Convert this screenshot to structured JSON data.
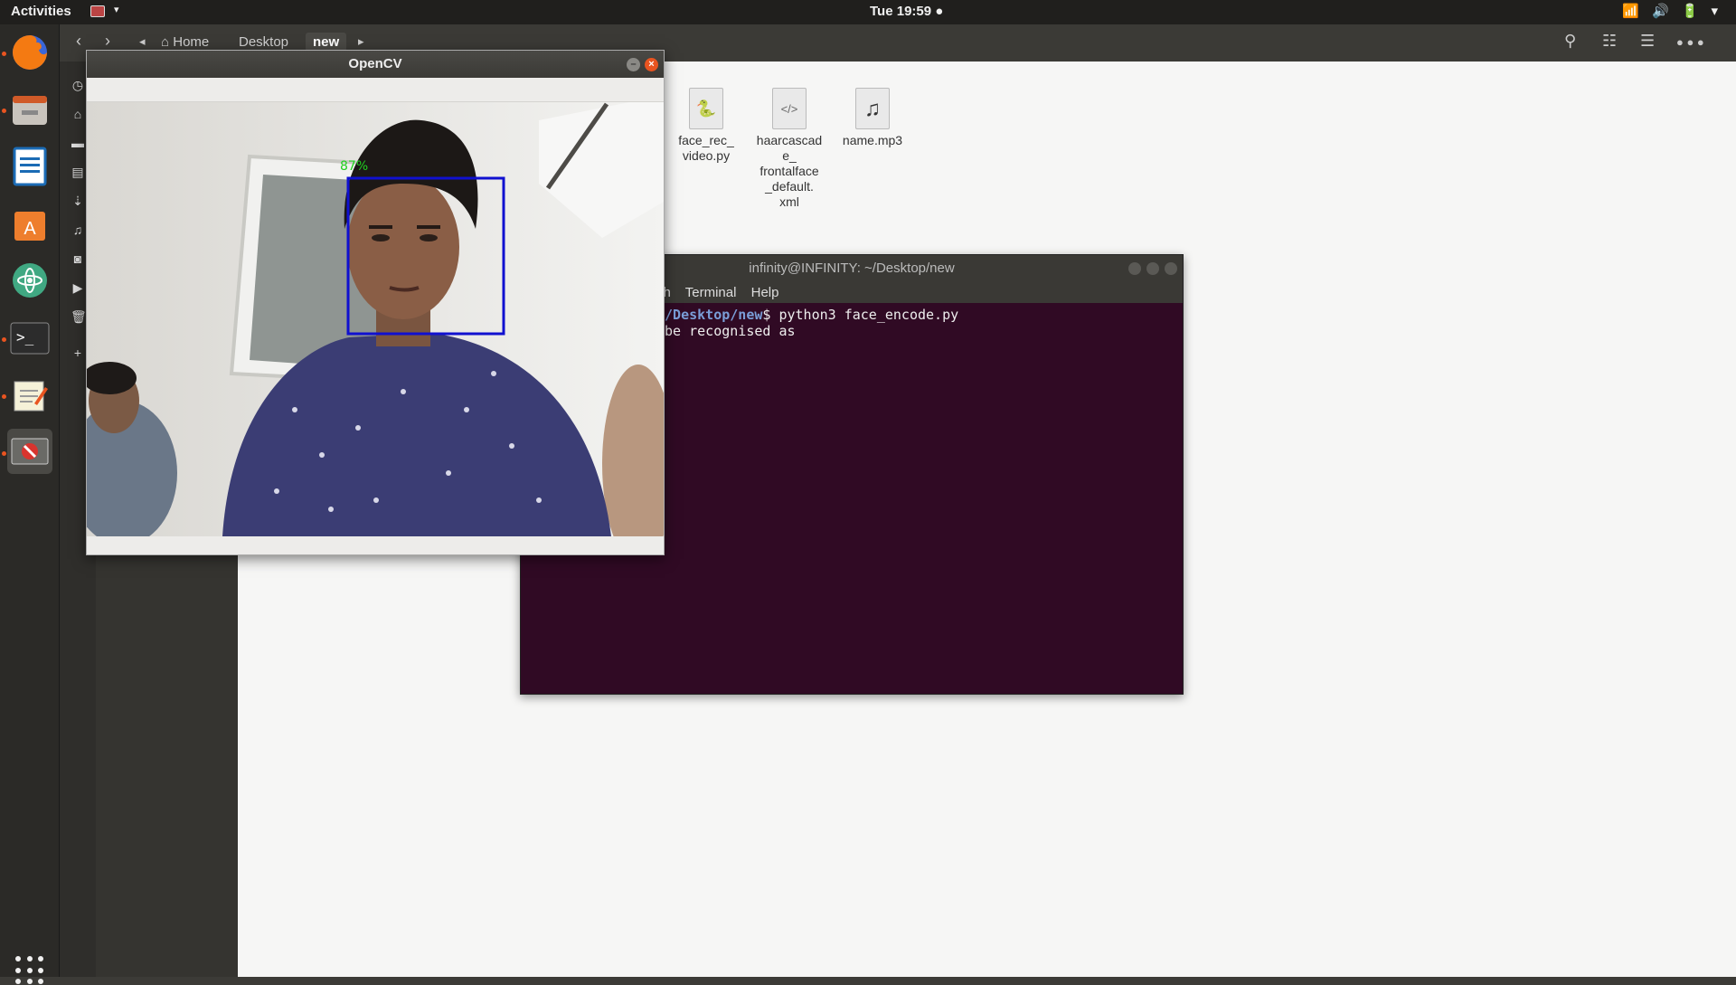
{
  "topbar": {
    "activities": "Activities",
    "clock": "Tue 19:59 ●",
    "appmenu_arrow": "▾",
    "tray": [
      "wifi-icon",
      "volume-icon",
      "battery-icon",
      "menu-arrow"
    ]
  },
  "dock": {
    "items": [
      "firefox",
      "files",
      "libreoffice-writer",
      "software-center",
      "atom",
      "terminal",
      "text-editor",
      "opencv-window"
    ]
  },
  "files": {
    "nav": {
      "back": "‹",
      "forward": "›",
      "left_arrow": "◂",
      "right_arrow": "▸"
    },
    "breadcrumbs": [
      "Home",
      "Desktop",
      "new"
    ],
    "items": [
      {
        "name": "face_rec_\nvideo.py",
        "icon": "python-file-icon",
        "glyph": "🐍"
      },
      {
        "name": "haarcascad\ne_\nfrontalface\n_default.\nxml",
        "icon": "xml-file-icon",
        "glyph": "</>"
      },
      {
        "name": "name.mp3",
        "icon": "audio-file-icon",
        "glyph": "♫"
      }
    ]
  },
  "terminal": {
    "title": "infinity@INFINITY: ~/Desktop/new",
    "menu": [
      "ch",
      "Terminal",
      "Help"
    ],
    "line1_path": "~/Desktop/new",
    "line1_cmd": "$ python3 face_encode.py",
    "line2": "be recognised as"
  },
  "opencv": {
    "title": "OpenCV",
    "confidence": "87%",
    "colors": {
      "box": "#1010d0",
      "label": "#20d020"
    }
  }
}
